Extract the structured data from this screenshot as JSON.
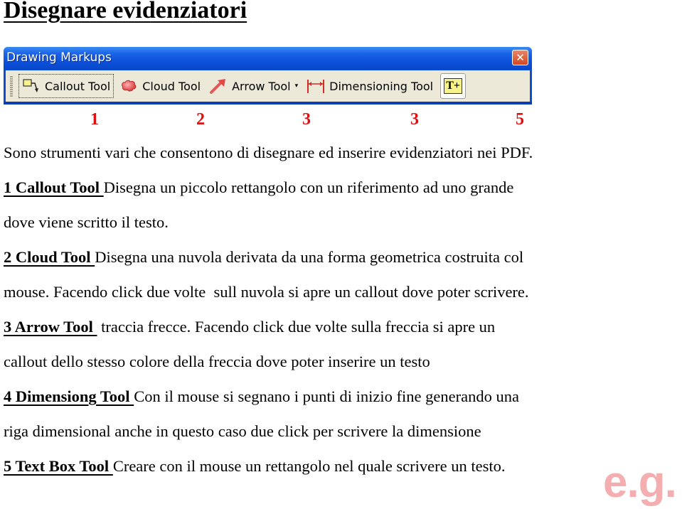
{
  "title": "Disegnare evidenziatori",
  "window": {
    "title": "Drawing Markups",
    "close_icon": "close-icon",
    "tools": [
      {
        "label": "Callout Tool",
        "icon": "callout-icon",
        "selected": true
      },
      {
        "label": "Cloud Tool",
        "icon": "cloud-icon"
      },
      {
        "label": "Arrow Tool",
        "icon": "arrow-icon",
        "dropdown": "▾"
      },
      {
        "label": "Dimensioning Tool",
        "icon": "dimension-icon"
      },
      {
        "label": "",
        "icon": "text-box-icon",
        "glyph": "T+"
      }
    ]
  },
  "numbers": [
    "1",
    "2",
    "3",
    "3",
    "5"
  ],
  "body": {
    "intro": "Sono strumenti vari che consentono di disegnare ed inserire evidenziatori nei PDF.",
    "items": [
      {
        "heading": "1 Callout Tool ",
        "text": "Disegna un piccolo rettangolo con un riferimento ad uno grande",
        "cont": "dove viene scritto il testo."
      },
      {
        "heading": "2 Cloud Tool ",
        "text": "Disegna una nuvola derivata da una forma geometrica costruita col",
        "cont": "mouse. Facendo click due volte  sull nuvola si apre un callout dove poter scrivere."
      },
      {
        "heading": "3 Arrow Tool ",
        "text": " traccia frecce. Facendo click due volte sulla freccia si apre un",
        "cont": "callout dello stesso colore della freccia dove poter inserire un testo"
      },
      {
        "heading": "4 Dimensiong Tool ",
        "text": "Con il mouse si segnano i punti di inizio fine generando una",
        "cont": "riga dimensional anche in questo caso due click per scrivere la dimensione"
      },
      {
        "heading": "5 Text Box Tool ",
        "text": "Creare con il mouse un rettangolo nel quale scrivere un testo."
      }
    ]
  },
  "watermark": "e.g."
}
